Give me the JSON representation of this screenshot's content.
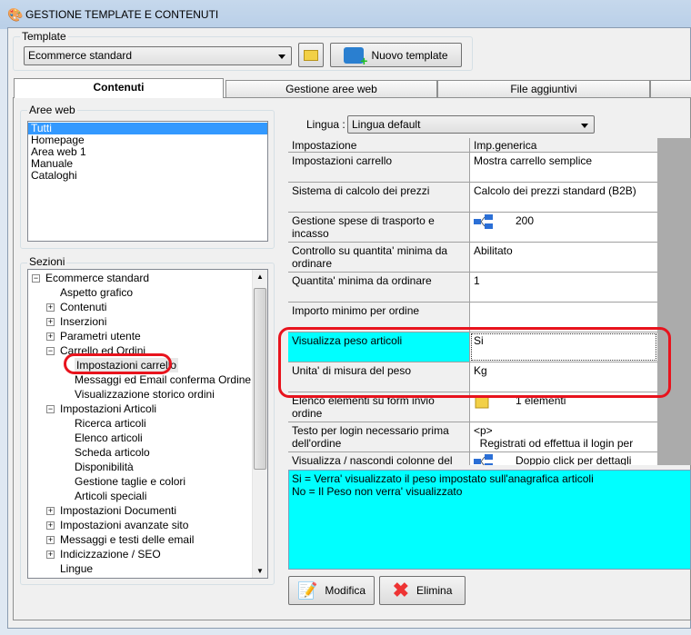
{
  "window": {
    "title": "GESTIONE TEMPLATE E CONTENUTI"
  },
  "template": {
    "label": "Template",
    "selected": "Ecommerce standard",
    "new_button": "Nuovo template"
  },
  "tabs": [
    {
      "label": "Contenuti",
      "active": true
    },
    {
      "label": "Gestione aree web"
    },
    {
      "label": "File aggiuntivi"
    }
  ],
  "aree_web": {
    "label": "Aree web",
    "items": [
      "Tutti",
      "Homepage",
      "Area web 1",
      "Manuale",
      "Cataloghi"
    ],
    "selected": "Tutti"
  },
  "sezioni": {
    "label": "Sezioni",
    "items": [
      {
        "label": "Ecommerce standard",
        "level": 0,
        "expander": "minus"
      },
      {
        "label": "Aspetto grafico",
        "level": 1
      },
      {
        "label": "Contenuti",
        "level": 1,
        "expander": "plus"
      },
      {
        "label": "Inserzioni",
        "level": 1,
        "expander": "plus"
      },
      {
        "label": "Parametri utente",
        "level": 1,
        "expander": "plus"
      },
      {
        "label": "Carrello ed Ordini",
        "level": 1,
        "expander": "minus"
      },
      {
        "label": "Impostazioni carrello",
        "level": 2,
        "selected": true
      },
      {
        "label": "Messaggi ed Email conferma Ordine",
        "level": 2
      },
      {
        "label": "Visualizzazione storico ordini",
        "level": 2
      },
      {
        "label": "Impostazioni Articoli",
        "level": 1,
        "expander": "minus"
      },
      {
        "label": "Ricerca articoli",
        "level": 2
      },
      {
        "label": "Elenco articoli",
        "level": 2
      },
      {
        "label": "Scheda articolo",
        "level": 2
      },
      {
        "label": "Disponibilità",
        "level": 2
      },
      {
        "label": "Gestione taglie e colori",
        "level": 2
      },
      {
        "label": "Articoli speciali",
        "level": 2
      },
      {
        "label": "Impostazioni Documenti",
        "level": 1,
        "expander": "plus"
      },
      {
        "label": "Impostazioni avanzate sito",
        "level": 1,
        "expander": "plus"
      },
      {
        "label": "Messaggi e testi delle email",
        "level": 1,
        "expander": "plus"
      },
      {
        "label": "Indicizzazione / SEO",
        "level": 1,
        "expander": "plus"
      },
      {
        "label": "Lingue",
        "level": 1
      }
    ]
  },
  "lingua": {
    "label": "Lingua :",
    "selected": "Lingua default"
  },
  "grid": {
    "headers": [
      "Impostazione",
      "Imp.generica"
    ],
    "rows": [
      {
        "name": "Impostazioni carrello",
        "value": "Mostra carrello semplice"
      },
      {
        "name": "Sistema di calcolo dei prezzi",
        "value": "Calcolo dei prezzi standard (B2B)"
      },
      {
        "name": "Gestione spese di trasporto e incasso",
        "value": "200",
        "icon": "tree-icon"
      },
      {
        "name": "Controllo su quantita' minima da ordinare",
        "value": "Abilitato"
      },
      {
        "name": "Quantita' minima da ordinare",
        "value": "1"
      },
      {
        "name": "Importo minimo per ordine",
        "value": ""
      },
      {
        "name": "Visualizza peso articoli",
        "value": "Si",
        "selected": true
      },
      {
        "name": "Unita' di misura del peso",
        "value": "Kg"
      },
      {
        "name": "Elenco elementi su form invio ordine",
        "value": "1 elementi",
        "icon": "folder-icon"
      },
      {
        "name": "Testo per login necessario prima dell'ordine",
        "value": "<p>\n  Registrati od effettua il login per"
      },
      {
        "name": "Visualizza / nascondi colonne del",
        "value": "Doppio click per dettagli",
        "icon": "tree-icon"
      }
    ]
  },
  "description": [
    "Si = Verra' visualizzato il peso impostato sull'anagrafica articoli",
    "No = Il Peso non verra' visualizzato"
  ],
  "buttons": {
    "modifica": "Modifica",
    "elimina": "Elimina"
  },
  "colors": {
    "selection": "#00ffff",
    "highlight_annotation": "#e8131d",
    "list_selection": "#3399ff"
  }
}
